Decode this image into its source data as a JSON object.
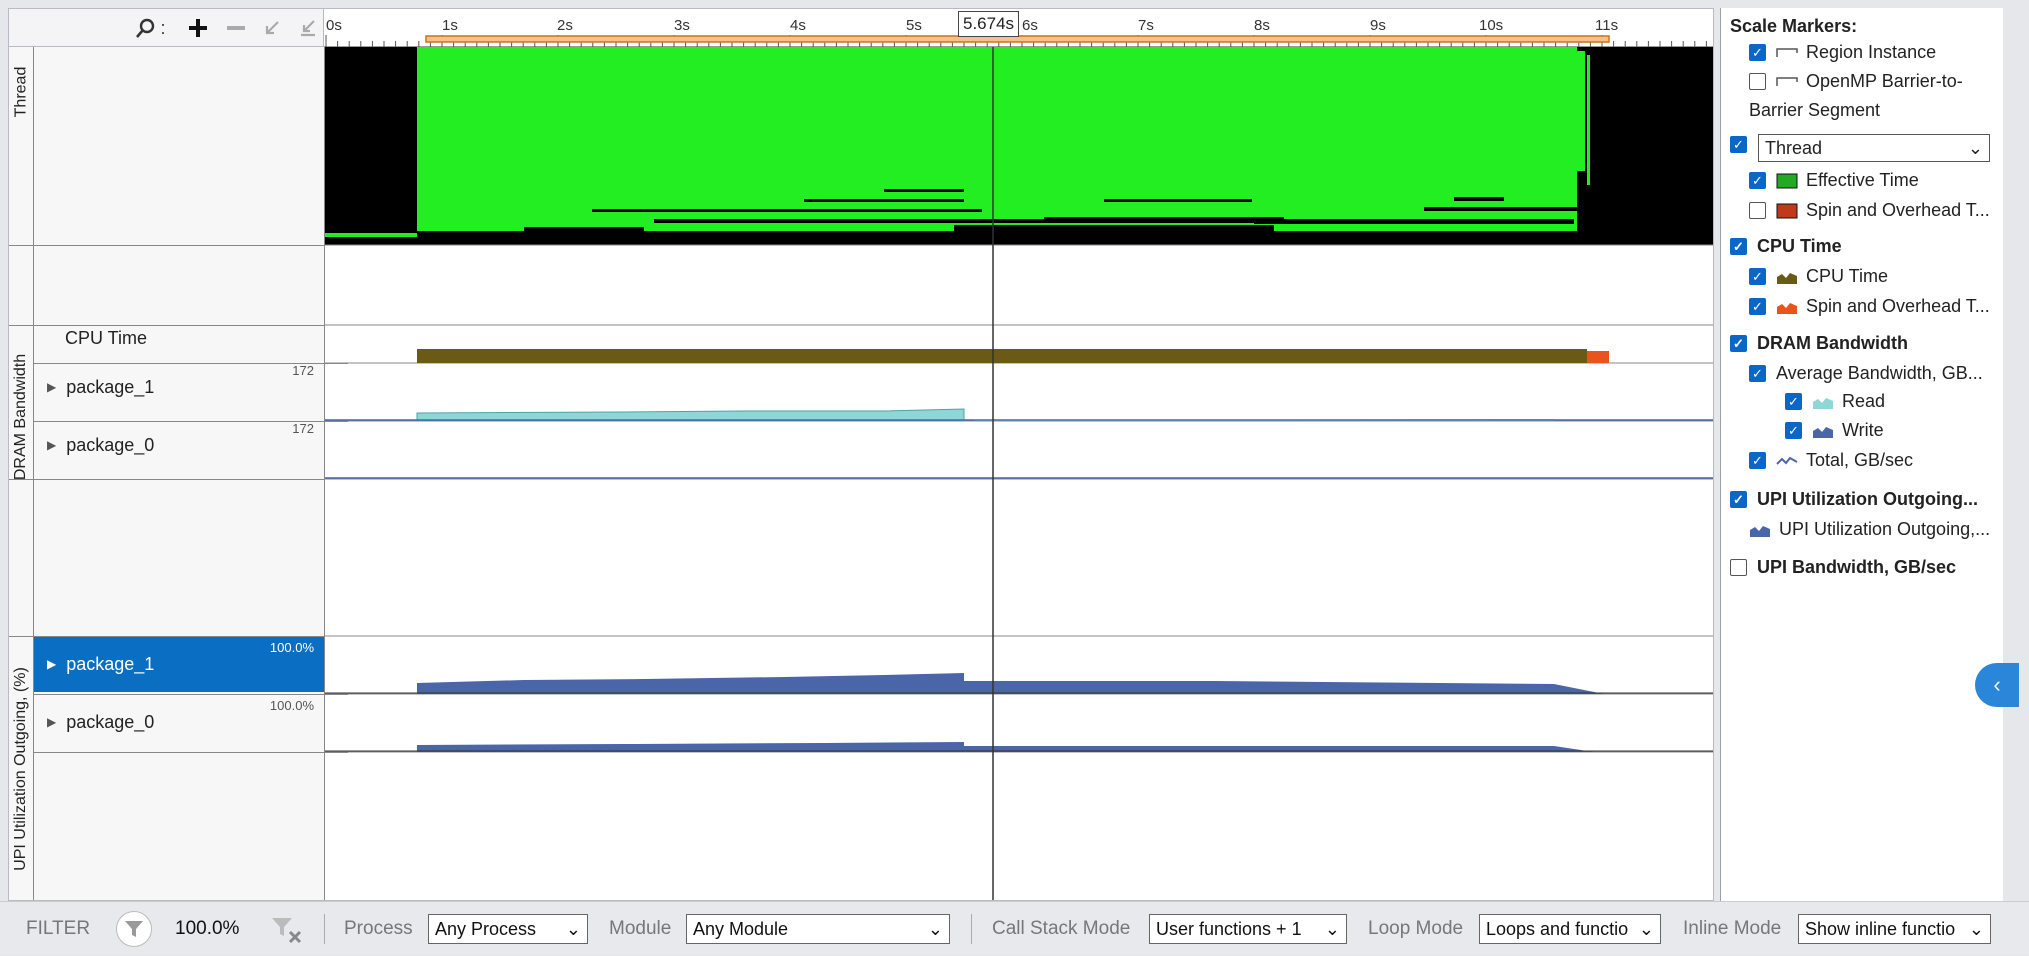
{
  "toolbar": {
    "search_icon": "search-icon",
    "zoom_in_icon": "zoom-in-icon",
    "zoom_out_icon": "zoom-out-icon",
    "undo_zoom_icon": "undo-zoom-icon",
    "reset_zoom_icon": "reset-zoom-icon"
  },
  "timeline": {
    "ticks": [
      "0s",
      "1s",
      "2s",
      "3s",
      "4s",
      "5s",
      "6s",
      "7s",
      "8s",
      "9s",
      "10s",
      "11s"
    ],
    "cursor_label": "5.674s"
  },
  "sections": {
    "thread": "Thread",
    "dram": "DRAM Bandwidth",
    "upi": "UPI Utilization Outgoing, (%)"
  },
  "rows": {
    "cpu_time": "CPU Time",
    "dram_pkg1": {
      "label": "package_1",
      "max": "172"
    },
    "dram_pkg0": {
      "label": "package_0",
      "max": "172"
    },
    "upi_pkg1": {
      "label": "package_1",
      "max": "100.0%"
    },
    "upi_pkg0": {
      "label": "package_0",
      "max": "100.0%"
    }
  },
  "legend": {
    "scale_markers": "Scale Markers:",
    "region_instance": "Region Instance",
    "openmp_1": "OpenMP Barrier-to-",
    "openmp_2": "Barrier Segment",
    "thread_select": "Thread",
    "effective_time": "Effective Time",
    "spin_overhead_1": "Spin and Overhead T...",
    "cpu_time_head": "CPU Time",
    "cpu_time": "CPU Time",
    "spin_overhead_2": "Spin and Overhead T...",
    "dram_head": "DRAM Bandwidth",
    "avg_bandwidth": "Average Bandwidth, GB...",
    "read": "Read",
    "write": "Write",
    "total": "Total, GB/sec",
    "upi_util_head": "UPI Utilization Outgoing...",
    "upi_util": "UPI Utilization Outgoing,...",
    "upi_bw_head": "UPI Bandwidth, GB/sec"
  },
  "colors": {
    "effective": "#22ee22",
    "spin": "#c0391b",
    "cpu": "#6b5a16",
    "cpu_spin": "#e8541c",
    "read": "#8fd6d6",
    "write": "#4a66a8",
    "selected": "#0a6fc2"
  },
  "filter": {
    "label": "FILTER",
    "percent": "100.0%",
    "process_label": "Process",
    "process_value": "Any Process",
    "module_label": "Module",
    "module_value": "Any Module",
    "callstack_label": "Call Stack Mode",
    "callstack_value": "User functions + 1",
    "loop_label": "Loop Mode",
    "loop_value": "Loops and functio",
    "inline_label": "Inline Mode",
    "inline_value": "Show inline functio"
  }
}
